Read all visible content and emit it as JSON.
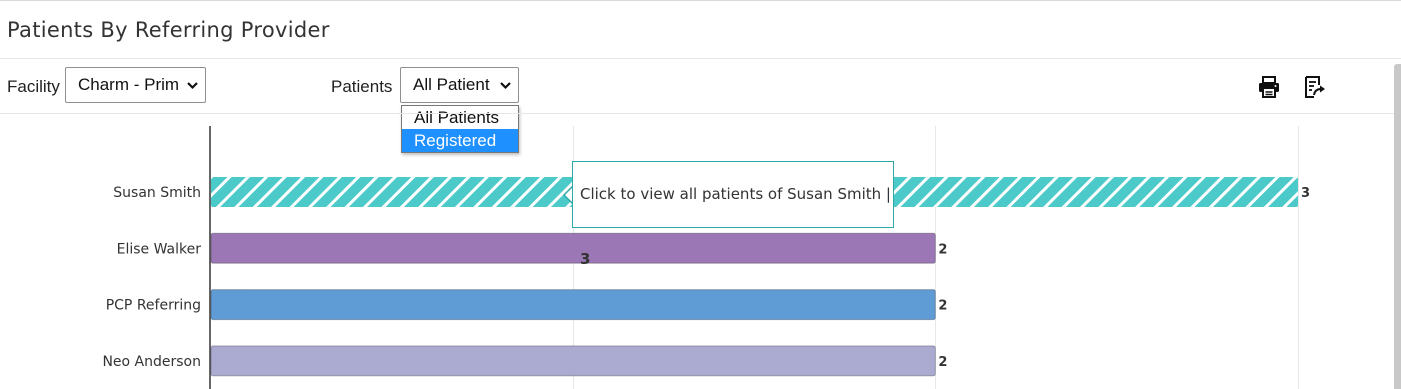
{
  "header": {
    "title": "Patients By Referring Provider"
  },
  "filters": {
    "facility_label": "Facility",
    "facility_value": "Charm - Prim",
    "patients_label": "Patients",
    "patients_value": "All Patient",
    "patients_options": [
      "All Patients",
      "Registered"
    ],
    "patients_highlighted": "Registered"
  },
  "toolbar": {
    "print_icon": "print-icon",
    "export_icon": "export-icon"
  },
  "tooltip": {
    "text": "Click to view all patients of Susan Smith | ",
    "value": "3"
  },
  "chart_data": {
    "type": "bar",
    "orientation": "horizontal",
    "categories": [
      "Susan Smith",
      "Elise Walker",
      "PCP Referring",
      "Neo Anderson"
    ],
    "values": [
      3,
      2,
      2,
      2
    ],
    "value_labels": [
      "3",
      "2",
      "2",
      "2"
    ],
    "colors": [
      "#4cc9c9",
      "#9b78b5",
      "#5f9bd4",
      "#ababd2"
    ],
    "highlighted_index": 0,
    "highlight_pattern": "diagonal-stripes",
    "xlim": [
      0,
      3
    ],
    "grid": true
  }
}
